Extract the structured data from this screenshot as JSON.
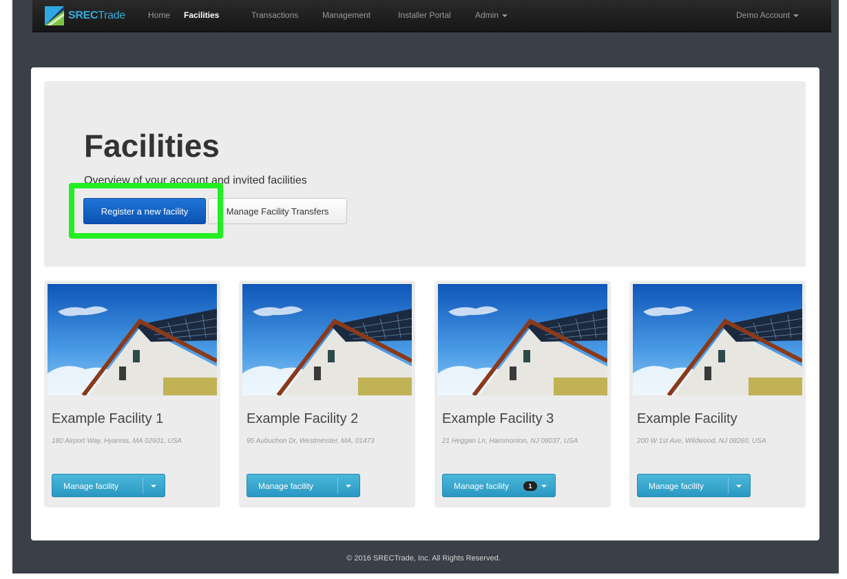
{
  "brand": {
    "name_bold": "SREC",
    "name_rest": "Trade"
  },
  "nav": {
    "items": [
      "Home",
      "Facilities",
      "Transactions",
      "Management",
      "Installer Portal",
      "Admin"
    ],
    "account": "Demo Account"
  },
  "jumbotron": {
    "title": "Facilities",
    "subtitle": "Overview of your account and invited facilities",
    "register_button": "Register a new facility",
    "transfers_button": "Manage Facility Transfers"
  },
  "facilities": [
    {
      "title": "Example Facility 1",
      "address": "180 Airport Way, Hyannis, MA 02601, USA",
      "button": "Manage facility",
      "badge": ""
    },
    {
      "title": "Example Facility 2",
      "address": "95 Aubuchon Dr, Westminster, MA, 01473",
      "button": "Manage facility",
      "badge": ""
    },
    {
      "title": "Example Facility 3",
      "address": "21 Heggan Ln, Hammonton, NJ 08037, USA",
      "button": "Manage facility",
      "badge": "1"
    },
    {
      "title": "Example Facility",
      "address": "200 W 1st Ave, Wildwood, NJ 08260, USA",
      "button": "Manage facility",
      "badge": ""
    }
  ],
  "footer": "© 2016 SRECTrade, Inc. All Rights Reserved.",
  "colors": {
    "background": "#3a3f48",
    "navbar": "#1e1e1e",
    "brand": "#35aadc",
    "primary_button": "#1565c8",
    "card_button": "#3aa8d0",
    "highlight": "#22ee22"
  }
}
